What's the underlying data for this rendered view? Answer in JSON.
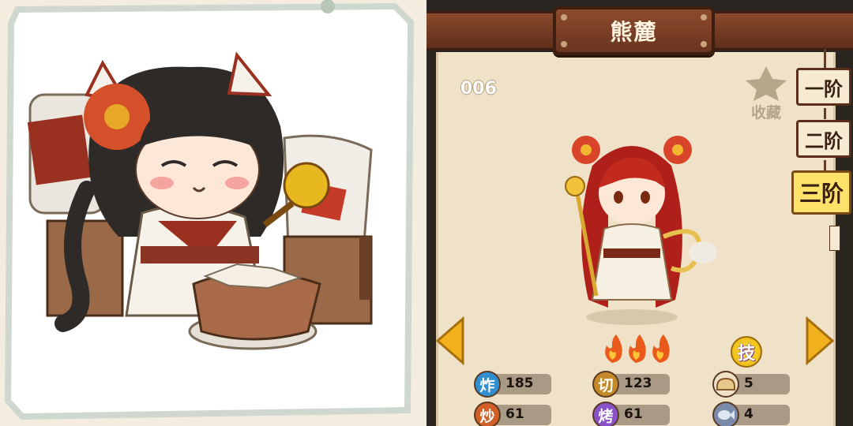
{
  "character": {
    "name": "熊麓",
    "number": "006"
  },
  "favorite": {
    "label": "收藏",
    "icon": "star-icon"
  },
  "tiers": [
    {
      "label": "一阶",
      "active": false
    },
    {
      "label": "二阶",
      "active": false
    },
    {
      "label": "三阶",
      "active": true
    }
  ],
  "rarity": {
    "flames": 3,
    "icon": "flame-icon"
  },
  "skill": {
    "label": "技"
  },
  "stats": [
    {
      "label": "炸",
      "value": "185",
      "color": "#2f8fd0"
    },
    {
      "label": "切",
      "value": "123",
      "color": "#c48a2a"
    },
    {
      "label": "",
      "value": "5",
      "icon": "bread-icon",
      "color": "#e8c88a"
    },
    {
      "label": "炒",
      "value": "61",
      "color": "#d06028"
    },
    {
      "label": "烤",
      "value": "61",
      "color": "#8a52c8"
    },
    {
      "label": "",
      "value": "4",
      "icon": "fish-icon",
      "color": "#7a8aa8"
    }
  ],
  "colors": {
    "accent": "#ffe26a",
    "wood": "#6a3520",
    "parchment": "#efe2c8"
  }
}
